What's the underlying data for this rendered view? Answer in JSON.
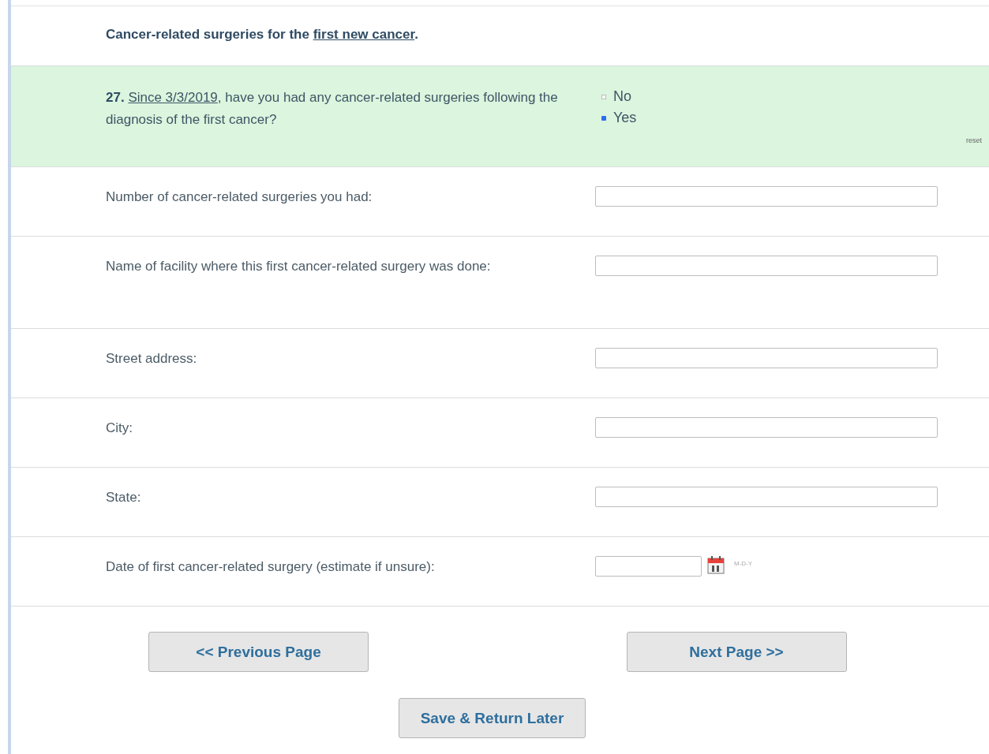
{
  "heading": {
    "text": "Cancer-related surgeries for the ",
    "link": "first new cancer",
    "end": "."
  },
  "question": {
    "number": "27.",
    "link": "Since 3/3/2019",
    "text": ", have you had any cancer-related surgeries following the diagnosis of the first cancer?",
    "options": [
      {
        "label": "No",
        "selected": false
      },
      {
        "label": "Yes",
        "selected": true
      }
    ],
    "reset": "reset"
  },
  "fields": [
    {
      "kind": "text",
      "label": "Number of cancer-related surgeries you had:"
    },
    {
      "kind": "text",
      "label": "Name of facility where this first cancer-related surgery was done:"
    },
    {
      "kind": "text",
      "label": "Street address:"
    },
    {
      "kind": "text",
      "label": "City:"
    },
    {
      "kind": "text",
      "label": "State:"
    },
    {
      "kind": "date",
      "label": "Date of first cancer-related surgery (estimate if unsure):",
      "format": "M-D-Y"
    }
  ],
  "buttons": {
    "previous": "<< Previous Page",
    "next": "Next Page >>",
    "save": "Save & Return Later"
  }
}
